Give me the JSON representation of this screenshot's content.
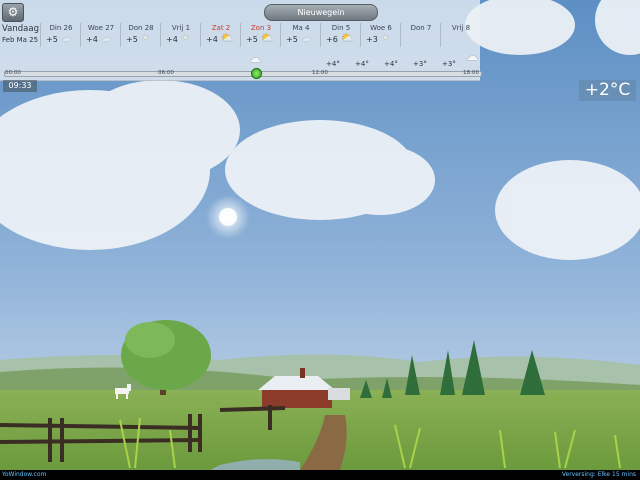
{
  "header": {
    "settings_icon": "gear-icon",
    "location": "Nieuwegein",
    "today_label": "Vandaag",
    "today_date": "Feb Ma 25"
  },
  "days": [
    {
      "name": "Din 26",
      "temp": "+5",
      "icon": "cloud",
      "highlight": false
    },
    {
      "name": "Woe 27",
      "temp": "+4",
      "icon": "cloud",
      "highlight": false
    },
    {
      "name": "Don 28",
      "temp": "+5",
      "icon": "sun",
      "highlight": false
    },
    {
      "name": "Vrij 1",
      "temp": "+4",
      "icon": "sun",
      "highlight": false
    },
    {
      "name": "Zat 2",
      "temp": "+4",
      "icon": "partly-cloudy",
      "highlight": true
    },
    {
      "name": "Zon 3",
      "temp": "+5",
      "icon": "partly-cloudy",
      "highlight": true
    },
    {
      "name": "Ma 4",
      "temp": "+5",
      "icon": "cloud",
      "highlight": false
    },
    {
      "name": "Din 5",
      "temp": "+6",
      "icon": "partly-cloudy",
      "highlight": false
    },
    {
      "name": "Woe 6",
      "temp": "+3",
      "icon": "sun",
      "highlight": false
    },
    {
      "name": "Don 7",
      "temp": "",
      "icon": "",
      "highlight": false
    },
    {
      "name": "Vrij 8",
      "temp": "",
      "icon": "",
      "highlight": false
    }
  ],
  "hourly": {
    "temps": [
      "+4°",
      "+4°",
      "+4°",
      "+3°",
      "+3°"
    ],
    "time_labels": [
      "00:00",
      "06:00",
      "12:00",
      "18:00"
    ],
    "marker_fraction": 0.53
  },
  "clock": "09:33",
  "current_temp": "+2°C",
  "footer": {
    "brand": "YoWindow.com",
    "refresh": "Verversing: Elke 15 mins"
  },
  "colors": {
    "sky_top": "#5d8fc4",
    "sky_bottom": "#cddced",
    "grass": "#7aa84a",
    "accent_red": "#d23a2a",
    "marker_green": "#3cb82a"
  }
}
